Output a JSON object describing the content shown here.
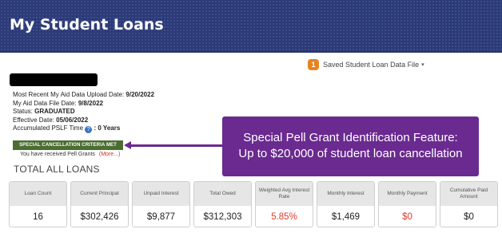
{
  "header": {
    "title": "My Student Loans"
  },
  "saved_file": {
    "badge": "1",
    "label": "Saved Student Loan Data File",
    "caret": "▾"
  },
  "info": {
    "upload_label": "Most Recent My Aid Data Upload Date:",
    "upload_value": "9/20/2022",
    "file_label": "My Aid Data File Date:",
    "file_value": "9/8/2022",
    "status_label": "Status:",
    "status_value": "GRADUATED",
    "effective_label": "Effective Date:",
    "effective_value": "05/06/2022",
    "pslf_label": "Accumulated PSLF Time",
    "pslf_value": ": 0 Years"
  },
  "criteria": {
    "label": "SPECIAL CANCELLATION CRITERIA MET"
  },
  "pell": {
    "text": "You have received Pell Grants",
    "more": "(More...)"
  },
  "callout": {
    "line1": "Special Pell Grant Identification Feature:",
    "line2": "Up to $20,000 of student loan cancellation"
  },
  "totals": {
    "title": "TOTAL ALL LOANS",
    "cards": [
      {
        "label": "Loan Count",
        "value": "16",
        "color": "#222222"
      },
      {
        "label": "Current Principal",
        "value": "$302,426",
        "color": "#222222"
      },
      {
        "label": "Unpaid Interest",
        "value": "$9,877",
        "color": "#222222"
      },
      {
        "label": "Total Owed",
        "value": "$312,303",
        "color": "#222222"
      },
      {
        "label": "Weighted Avg Interest Rate",
        "value": "5.85%",
        "color": "#e03a2c"
      },
      {
        "label": "Monthly Interest",
        "value": "$1,469",
        "color": "#222222"
      },
      {
        "label": "Monthly Payment",
        "value": "$0",
        "color": "#e03a2c"
      },
      {
        "label": "Cumulative Paid Amount",
        "value": "$0",
        "color": "#222222"
      }
    ]
  },
  "colors": {
    "header_bg": "#2b3a78",
    "badge": "#e8831f",
    "criteria": "#4a6e31",
    "callout": "#6a2a8f",
    "red": "#e03a2c"
  },
  "icons": {
    "help": "question-circle-icon",
    "arrow": "arrow-left-icon"
  }
}
